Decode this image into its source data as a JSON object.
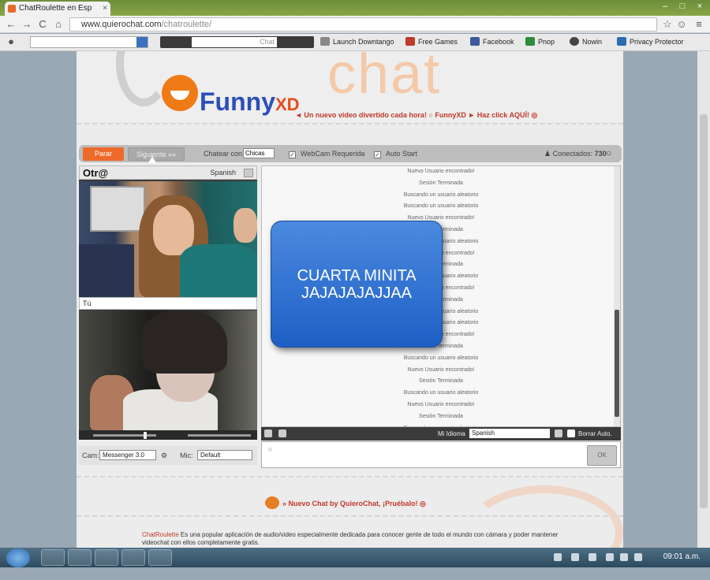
{
  "browser": {
    "tab_title": "ChatRoulette en Esp",
    "tab_close": "×",
    "url_domain": "www.quierochat.com",
    "url_path": "/chatroulette/",
    "window_buttons": [
      "–",
      "□",
      "×"
    ],
    "nav": {
      "back": "←",
      "forward": "→",
      "reload": "C",
      "home": "⌂"
    },
    "toolbar_field_text": "Chat",
    "bookmarks": [
      "Launch Downtango",
      "Free Games",
      "Facebook",
      "Pnop",
      "Nowin",
      "Privacy Protector"
    ]
  },
  "header": {
    "big_word": "chat",
    "logo_main": "Funny",
    "logo_suffix": "XD",
    "promo_text": "◄ Un nuevo video divertido cada hora! ○ FunnyXD ► Haz click AQUÍ! ◎"
  },
  "controls": {
    "stop_label": "Parar",
    "next_label": "Siguiente »»",
    "chat_with_label": "Chatear con",
    "chat_with_value": "Chicas",
    "webcam_label": "WebCam Requerida",
    "autostart_label": "Auto Start",
    "connected_label": "Conectados:",
    "connected_count": "730"
  },
  "video": {
    "partner_name": "Otr@",
    "partner_lang": "Spanish",
    "self_label": "Tú",
    "cam_label": "Cam:",
    "cam_value": "Messenger 3.0",
    "mic_label": "Mic:",
    "mic_value": "Default"
  },
  "chat": {
    "log": [
      "Nuevo Usuario encontrado!",
      "Sesión Terminada",
      "Buscando un usuario aleatorio",
      "Buscando un usuario aleatorio",
      "Nuevo Usuario encontrado!",
      "Sesión Terminada",
      "Buscando un usuario aleatorio",
      "Nuevo Usuario encontrado!",
      "Sesión Terminada",
      "Buscando un usuario aleatorio",
      "Nuevo Usuario encontrado!",
      "Sesión Terminada",
      "Buscando un usuario aleatorio",
      "Buscando un usuario aleatorio",
      "Nuevo Usuario encontrado!",
      "Sesión Terminada",
      "Buscando un usuario aleatorio",
      "Nuevo Usuario encontrado!",
      "Sesión Terminada",
      "Buscando un usuario aleatorio",
      "Nuevo Usuario encontrado!",
      "Sesión Terminada",
      "Buscando un usuario aleatorio",
      "Nuevo Usuario encontrado!"
    ],
    "language_label": "Mi Idioma",
    "language_value": "Spanish",
    "clear_auto_label": "Borrar Auto.",
    "send_label": "OK"
  },
  "overlay_caption": "CUARTA MINITA\nJAJAJAJAJJAA",
  "footer": {
    "nuevo_chat": "» Nuevo Chat by QuieroChat, ¡Pruébalo! ◎",
    "desc_brand": "ChatRoulette",
    "desc_text": " Es una popular aplicación de audio/video especialmente dedicada para conocer gente de todo el mundo con cámara y poder mantener videochat con ellos completamente gratis."
  },
  "taskbar": {
    "clock": "09:01 a.m."
  },
  "colors": {
    "accent_orange": "#ec6b2a",
    "overlay_blue": "#2f6fd0",
    "logo_blue": "#2c4fb8"
  }
}
